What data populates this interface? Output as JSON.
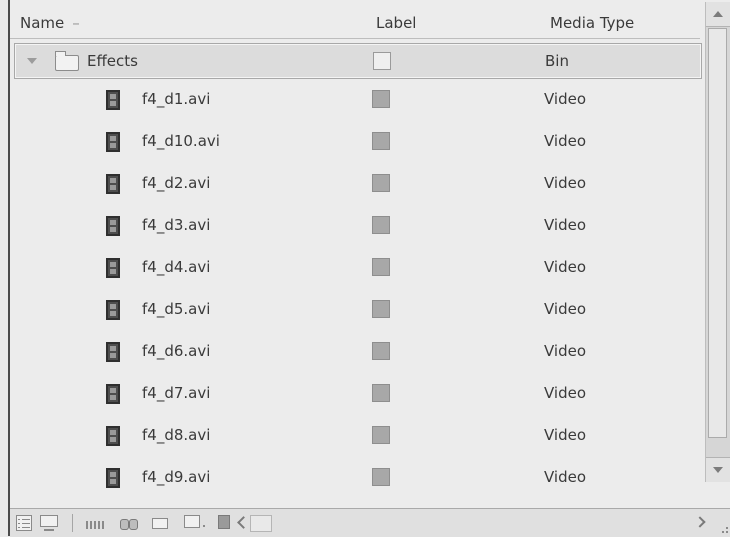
{
  "columns": {
    "name": "Name",
    "sort_indicator": "–",
    "label": "Label",
    "media_type": "Media Type"
  },
  "bin": {
    "name": "Effects",
    "media_type": "Bin",
    "icon": "folder-icon"
  },
  "items": [
    {
      "name": "f4_d1.avi",
      "media_type": "Video"
    },
    {
      "name": "f4_d10.avi",
      "media_type": "Video"
    },
    {
      "name": "f4_d2.avi",
      "media_type": "Video"
    },
    {
      "name": "f4_d3.avi",
      "media_type": "Video"
    },
    {
      "name": "f4_d4.avi",
      "media_type": "Video"
    },
    {
      "name": "f4_d5.avi",
      "media_type": "Video"
    },
    {
      "name": "f4_d6.avi",
      "media_type": "Video"
    },
    {
      "name": "f4_d7.avi",
      "media_type": "Video"
    },
    {
      "name": "f4_d8.avi",
      "media_type": "Video"
    },
    {
      "name": "f4_d9.avi",
      "media_type": "Video"
    }
  ],
  "colors": {
    "background": "#ececec",
    "label_swatch": "#a8a8a8",
    "selection": "#dcdcdc"
  },
  "footer_icons": [
    "list-view-icon",
    "icon-view-icon",
    "automate-to-sequence-icon",
    "find-icon",
    "new-bin-icon",
    "new-item-icon",
    "clear-icon",
    "scroll-left-icon"
  ]
}
